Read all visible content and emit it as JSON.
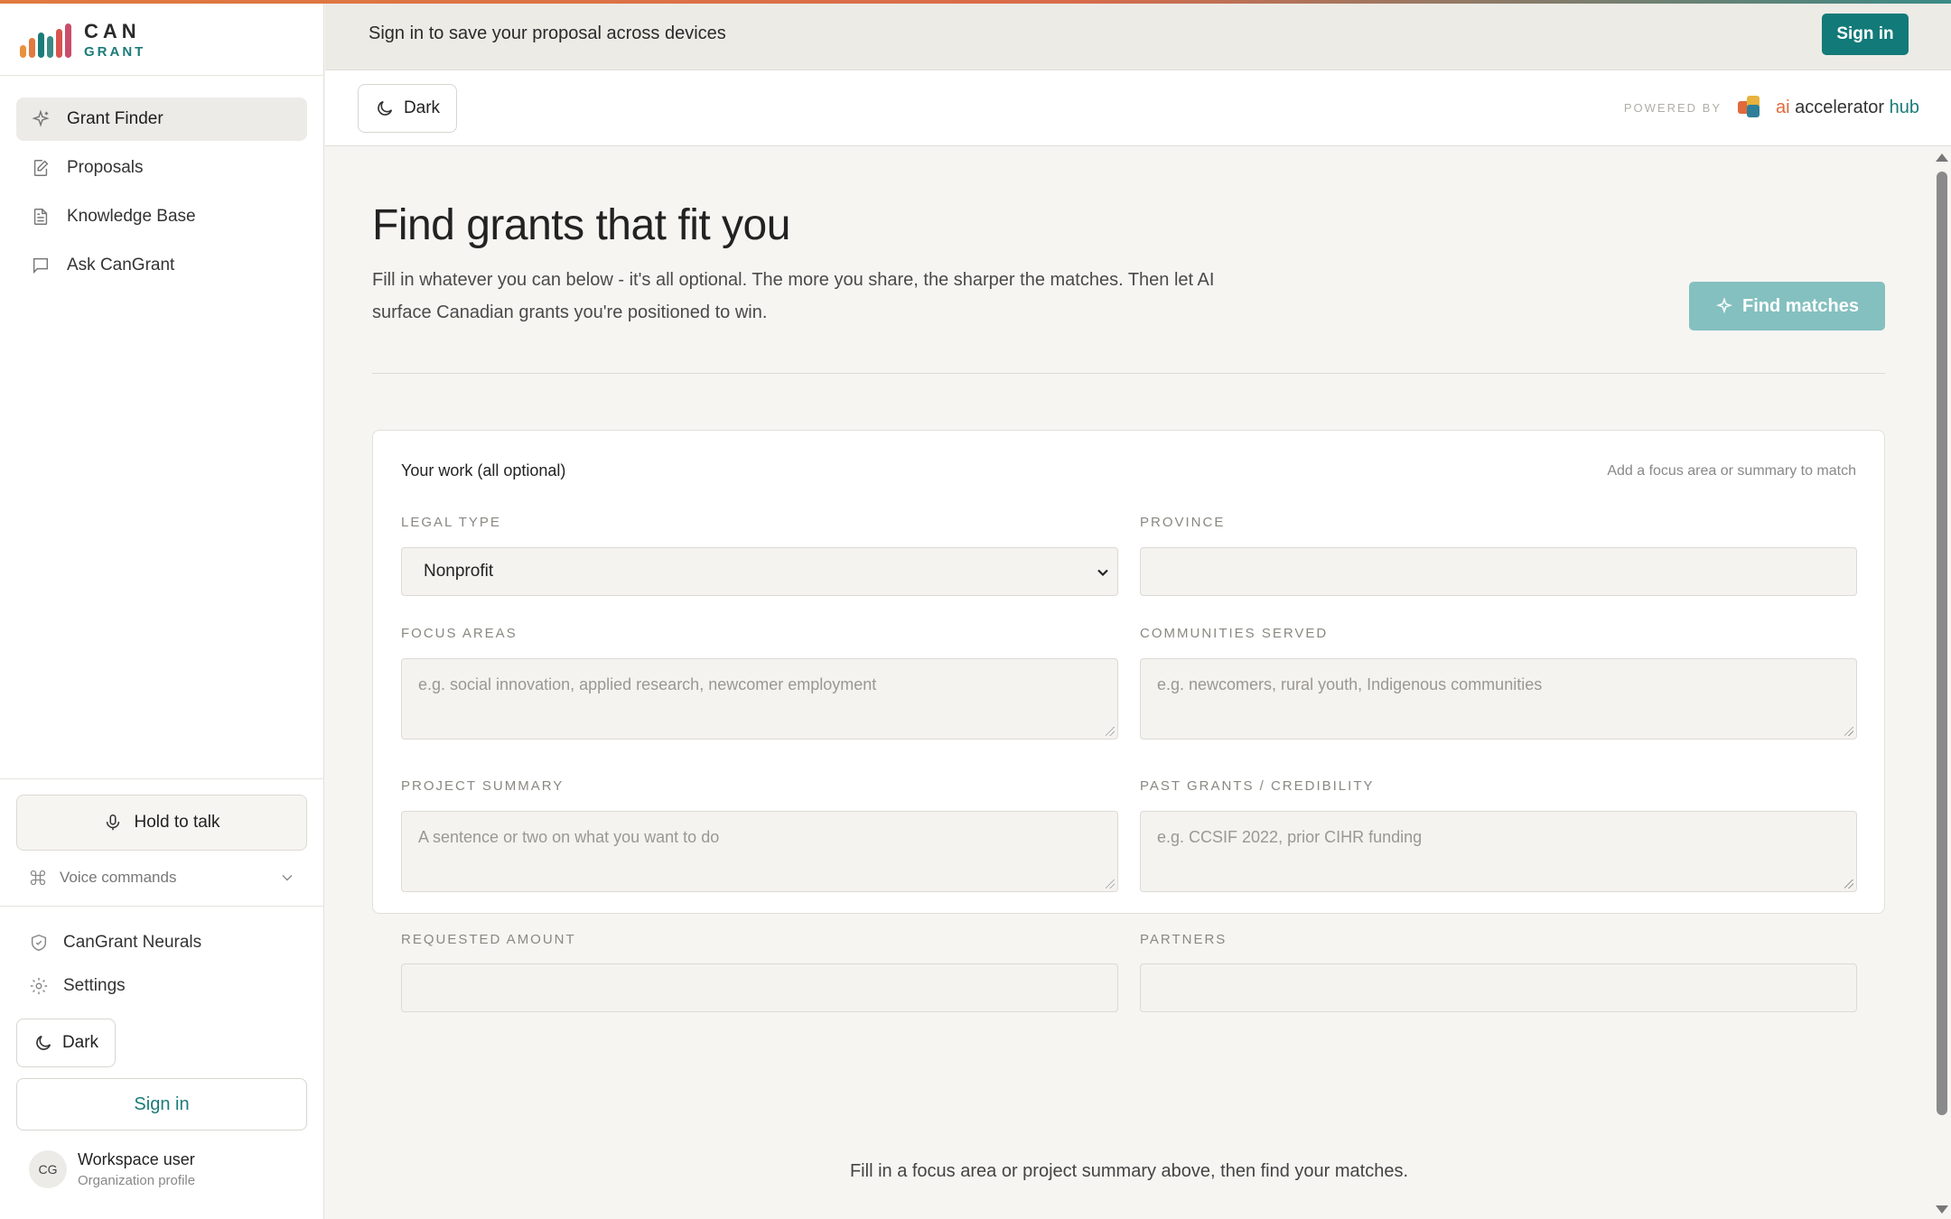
{
  "brand": {
    "name_top": "CAN",
    "name_bottom": "GRANT",
    "accent": "#127a78",
    "bar_colors": [
      "#e8913d",
      "#e07a3f",
      "#1b7c79",
      "#3a8a86",
      "#d9534f",
      "#c94d6a"
    ]
  },
  "sidebar": {
    "nav": [
      {
        "label": "Grant Finder",
        "icon": "sparkle-icon",
        "active": true
      },
      {
        "label": "Proposals",
        "icon": "edit-document-icon",
        "active": false
      },
      {
        "label": "Knowledge Base",
        "icon": "document-icon",
        "active": false
      },
      {
        "label": "Ask CanGrant",
        "icon": "chat-icon",
        "active": false
      }
    ],
    "hold_to_talk": "Hold to talk",
    "voice_commands": "Voice commands",
    "lower": [
      {
        "label": "CanGrant Neurals",
        "icon": "shield-check-icon"
      },
      {
        "label": "Settings",
        "icon": "gear-icon"
      }
    ],
    "dark_label": "Dark",
    "signin_label": "Sign in",
    "user": {
      "initials": "CG",
      "name": "Workspace user",
      "sub": "Organization profile"
    }
  },
  "banner": {
    "text": "Sign in to save your proposal across devices",
    "signin_label": "Sign in"
  },
  "toolbar": {
    "dark_label": "Dark",
    "powered_by": "POWERED BY",
    "partner_ai": "ai",
    "partner_mid": " accelerator ",
    "partner_hub": "hub"
  },
  "main": {
    "title": "Find grants that fit you",
    "lede": "Fill in whatever you can below - it's all optional. The more you share, the sharper the matches. Then let AI surface Canadian grants you're positioned to win.",
    "find_button": "Find matches",
    "footer": "Fill in a focus area or project summary above, then find your matches."
  },
  "form": {
    "title": "Your work (all optional)",
    "hint": "Add a focus area or summary to match",
    "legal_type": {
      "label": "LEGAL TYPE",
      "value": "Nonprofit"
    },
    "province": {
      "label": "PROVINCE",
      "value": ""
    },
    "focus_areas": {
      "label": "FOCUS AREAS",
      "placeholder": "e.g. social innovation, applied research, newcomer employment"
    },
    "communities": {
      "label": "COMMUNITIES SERVED",
      "placeholder": "e.g. newcomers, rural youth, Indigenous communities"
    },
    "summary": {
      "label": "PROJECT SUMMARY",
      "placeholder": "A sentence or two on what you want to do"
    },
    "past_grants": {
      "label": "PAST GRANTS / CREDIBILITY",
      "placeholder": "e.g. CCSIF 2022, prior CIHR funding"
    },
    "amount": {
      "label": "REQUESTED AMOUNT",
      "value": ""
    },
    "partners": {
      "label": "PARTNERS",
      "value": ""
    }
  }
}
